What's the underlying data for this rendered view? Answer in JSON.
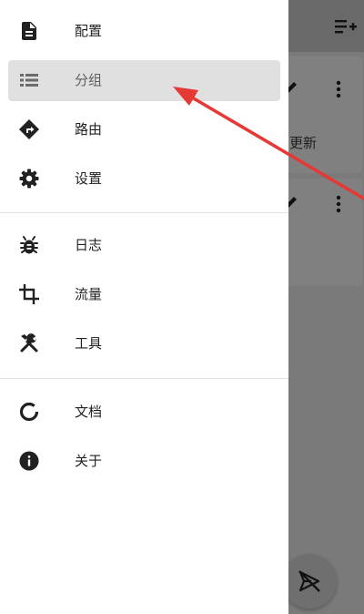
{
  "drawer": {
    "items": [
      {
        "label": "配置",
        "icon": "file-icon",
        "active": false
      },
      {
        "label": "分组",
        "icon": "list-icon",
        "active": true
      },
      {
        "label": "路由",
        "icon": "route-icon",
        "active": false
      },
      {
        "label": "设置",
        "icon": "gear-icon",
        "active": false
      },
      {
        "label": "日志",
        "icon": "bug-icon",
        "active": false
      },
      {
        "label": "流量",
        "icon": "crop-icon",
        "active": false
      },
      {
        "label": "工具",
        "icon": "tools-icon",
        "active": false
      },
      {
        "label": "文档",
        "icon": "donut-icon",
        "active": false
      },
      {
        "label": "关于",
        "icon": "info-icon",
        "active": false
      }
    ]
  },
  "background": {
    "card_text": "更新",
    "scrim_color": "#7a7a7a"
  },
  "annotation": {
    "arrow_color": "#e53935"
  }
}
